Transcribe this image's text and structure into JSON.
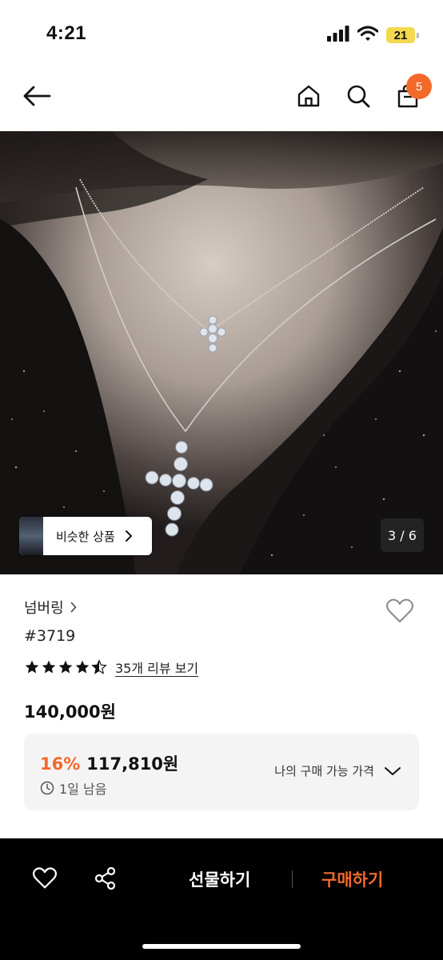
{
  "status_bar": {
    "time": "4:21",
    "battery_level": "21",
    "icons": [
      "cellular-signal-icon",
      "wifi-icon",
      "battery-icon"
    ]
  },
  "nav": {
    "icons": [
      "back-arrow-icon",
      "home-icon",
      "search-icon",
      "shopping-bag-icon"
    ],
    "cart_count": "5"
  },
  "hero": {
    "similar_label": "비슷한 상품",
    "counter": "3 / 6",
    "current_image": 3,
    "total_images": 6
  },
  "product": {
    "brand": "넘버링",
    "name": "#3719",
    "rating": 4.5,
    "max_rating": 5,
    "review_link": "35개 리뷰 보기",
    "price": "140,000원"
  },
  "discount": {
    "percent": "16%",
    "price": "117,810원",
    "timer": "1일 남음",
    "my_price_label": "나의 구매 가능 가격"
  },
  "bottom_bar": {
    "gift_label": "선물하기",
    "buy_label": "구매하기",
    "icons": [
      "heart-icon",
      "share-icon"
    ]
  },
  "colors": {
    "accent": "#f2692a",
    "battery": "#f2d94e",
    "bottom_bar_bg": "#000000",
    "discount_bg": "#f4f4f5"
  }
}
